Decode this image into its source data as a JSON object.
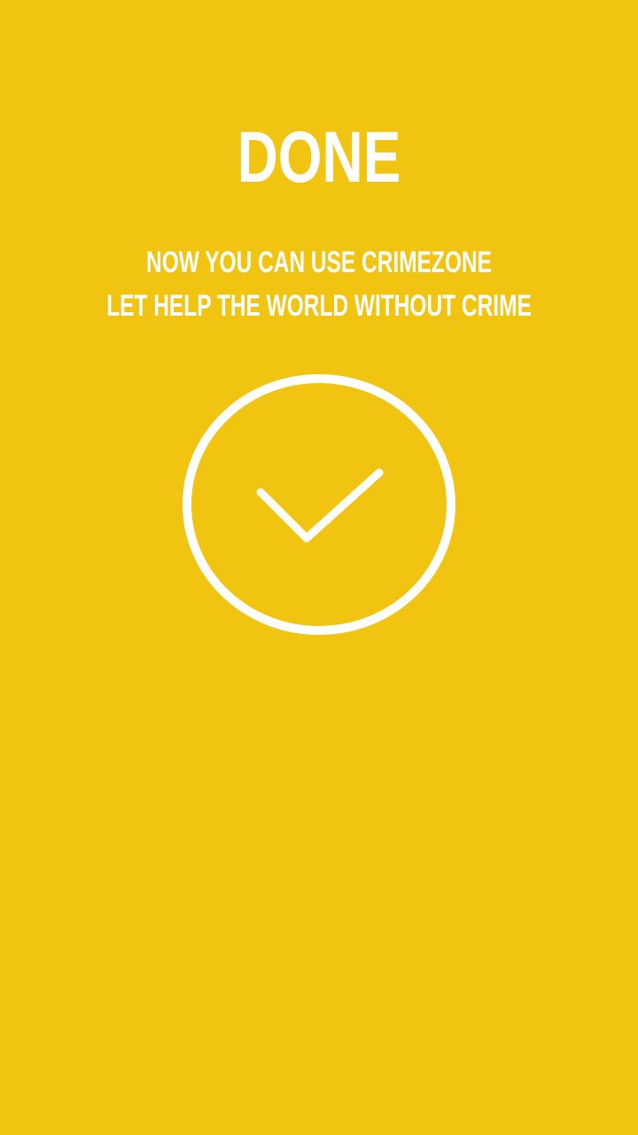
{
  "screen": {
    "title": "DONE",
    "subtitle_line1": "NOW YOU CAN USE CRIMEZONE",
    "subtitle_line2": "LET HELP THE WORLD WITHOUT CRIME",
    "icon": "check-circle-icon"
  },
  "colors": {
    "background": "#F0C410",
    "foreground": "#FFFFFF"
  }
}
